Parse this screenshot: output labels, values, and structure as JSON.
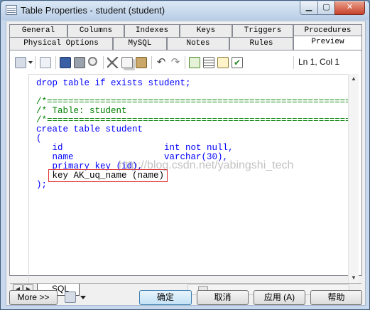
{
  "window": {
    "title": "Table Properties - student (student)",
    "controls": {
      "minimize": "▁",
      "maximize": "▢",
      "close": "✕"
    }
  },
  "tabs": {
    "row1": [
      "General",
      "Columns",
      "Indexes",
      "Keys",
      "Triggers",
      "Procedures"
    ],
    "row2": [
      "Physical Options",
      "MySQL",
      "Notes",
      "Rules",
      "Preview"
    ],
    "active": "Preview"
  },
  "toolbar": {
    "icons": [
      "properties-icon",
      "dropdown-arrow",
      "edit-icon",
      "save-icon",
      "print-icon",
      "find-icon",
      "cut-icon",
      "copy-icon",
      "paste-icon",
      "undo-icon",
      "redo-icon",
      "refresh-icon",
      "list-icon",
      "edit-script-icon",
      "check-icon"
    ],
    "cursor_position": "Ln 1, Col 1"
  },
  "code": {
    "lines": [
      {
        "text": "drop table if exists student;",
        "style": "kw"
      },
      {
        "text": "",
        "style": "tx"
      },
      {
        "text": "/*==============================================================*/",
        "style": "cm"
      },
      {
        "text": "/* Table: student                                               */",
        "style": "cm"
      },
      {
        "text": "/*==============================================================*/",
        "style": "cm"
      },
      {
        "text": "create table student",
        "style": "kw"
      },
      {
        "text": "(",
        "style": "kw"
      },
      {
        "text": "   id                   int not null,",
        "style": "kw"
      },
      {
        "text": "   name                 varchar(30),",
        "style": "kw"
      },
      {
        "text": "   primary key (id),",
        "style": "kw"
      },
      {
        "text": "   key AK_uq_name (name)",
        "style": "tx"
      },
      {
        "text": ");",
        "style": "kw"
      }
    ],
    "watermark": "http://blog.csdn.net/yabingshi_tech",
    "highlight_color": "#e03030"
  },
  "bottom_tab": "SQL",
  "buttons": {
    "more": "More >>",
    "ok": "确定",
    "cancel": "取消",
    "apply": "应用 (A)",
    "help": "帮助"
  },
  "colors": {
    "keyword": "#0000ff",
    "comment": "#008000",
    "title_bar": "#c7d8ec",
    "close_button": "#c8412a"
  }
}
